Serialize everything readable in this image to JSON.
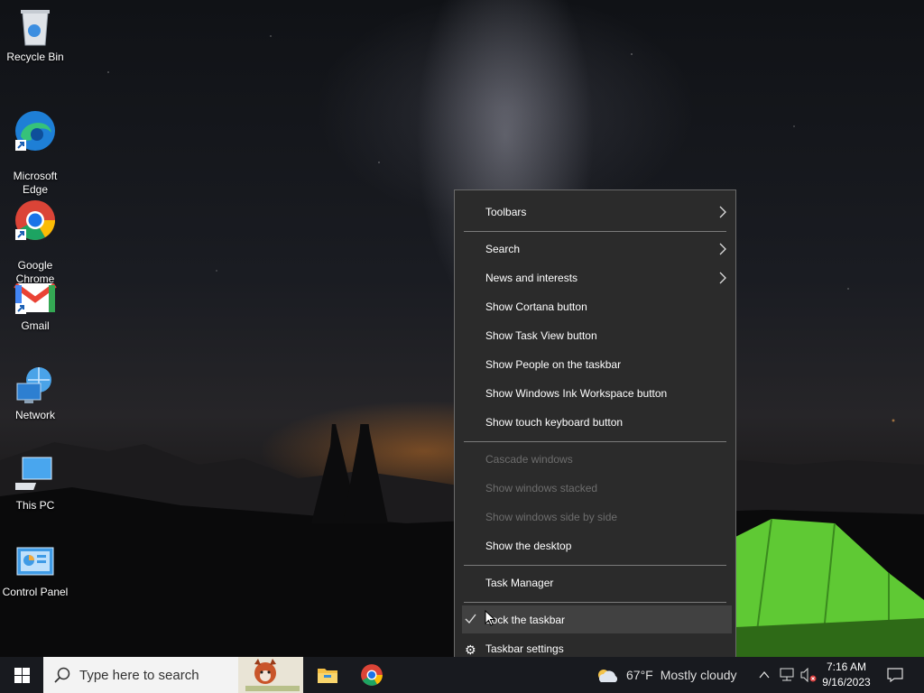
{
  "desktop": {
    "icons": [
      {
        "label": "Recycle Bin"
      },
      {
        "label": "Microsoft\nEdge"
      },
      {
        "label": "Google\nChrome"
      },
      {
        "label": "Gmail"
      },
      {
        "label": "Network"
      },
      {
        "label": "This PC"
      },
      {
        "label": "Control Panel"
      }
    ]
  },
  "context_menu": {
    "items": [
      {
        "label": "Toolbars",
        "submenu": true
      },
      {
        "label": "Search",
        "submenu": true
      },
      {
        "label": "News and interests",
        "submenu": true
      },
      {
        "label": "Show Cortana button"
      },
      {
        "label": "Show Task View button"
      },
      {
        "label": "Show People on the taskbar"
      },
      {
        "label": "Show Windows Ink Workspace button"
      },
      {
        "label": "Show touch keyboard button"
      },
      {
        "label": "Cascade windows",
        "disabled": true
      },
      {
        "label": "Show windows stacked",
        "disabled": true
      },
      {
        "label": "Show windows side by side",
        "disabled": true
      },
      {
        "label": "Show the desktop"
      },
      {
        "label": "Task Manager"
      },
      {
        "label": "Lock the taskbar",
        "checked": true
      },
      {
        "label": "Taskbar settings"
      }
    ]
  },
  "taskbar": {
    "search_placeholder": "Type here to search",
    "weather": {
      "temp": "67°F",
      "condition": "Mostly cloudy"
    },
    "clock": {
      "time": "7:16 AM",
      "date": "9/16/2023"
    }
  },
  "colors": {
    "menu_bg": "#2b2b2b",
    "menu_hover": "#414141",
    "taskbar_bg": "#181a1f",
    "edge_blue": "#1e7fd6",
    "chrome_green": "#1da462",
    "tent_green": "#6fd43a"
  }
}
